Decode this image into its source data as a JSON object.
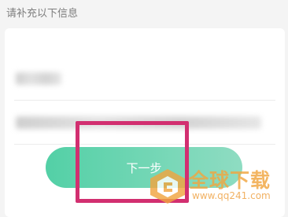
{
  "section": {
    "title": "请补充以下信息"
  },
  "form": {
    "field1": {
      "value_obscured": true
    },
    "field2": {
      "value_obscured": true
    },
    "next_button": {
      "label": "下一步"
    }
  },
  "annotation": {
    "color": "#d22f70"
  },
  "watermark": {
    "text": "全球下载",
    "url": "www.qq241.com"
  },
  "colors": {
    "background": "#f4f4f4",
    "button_gradient_start": "#53d0a6",
    "button_gradient_end": "#8fdcc2",
    "watermark": "#f1a640"
  }
}
